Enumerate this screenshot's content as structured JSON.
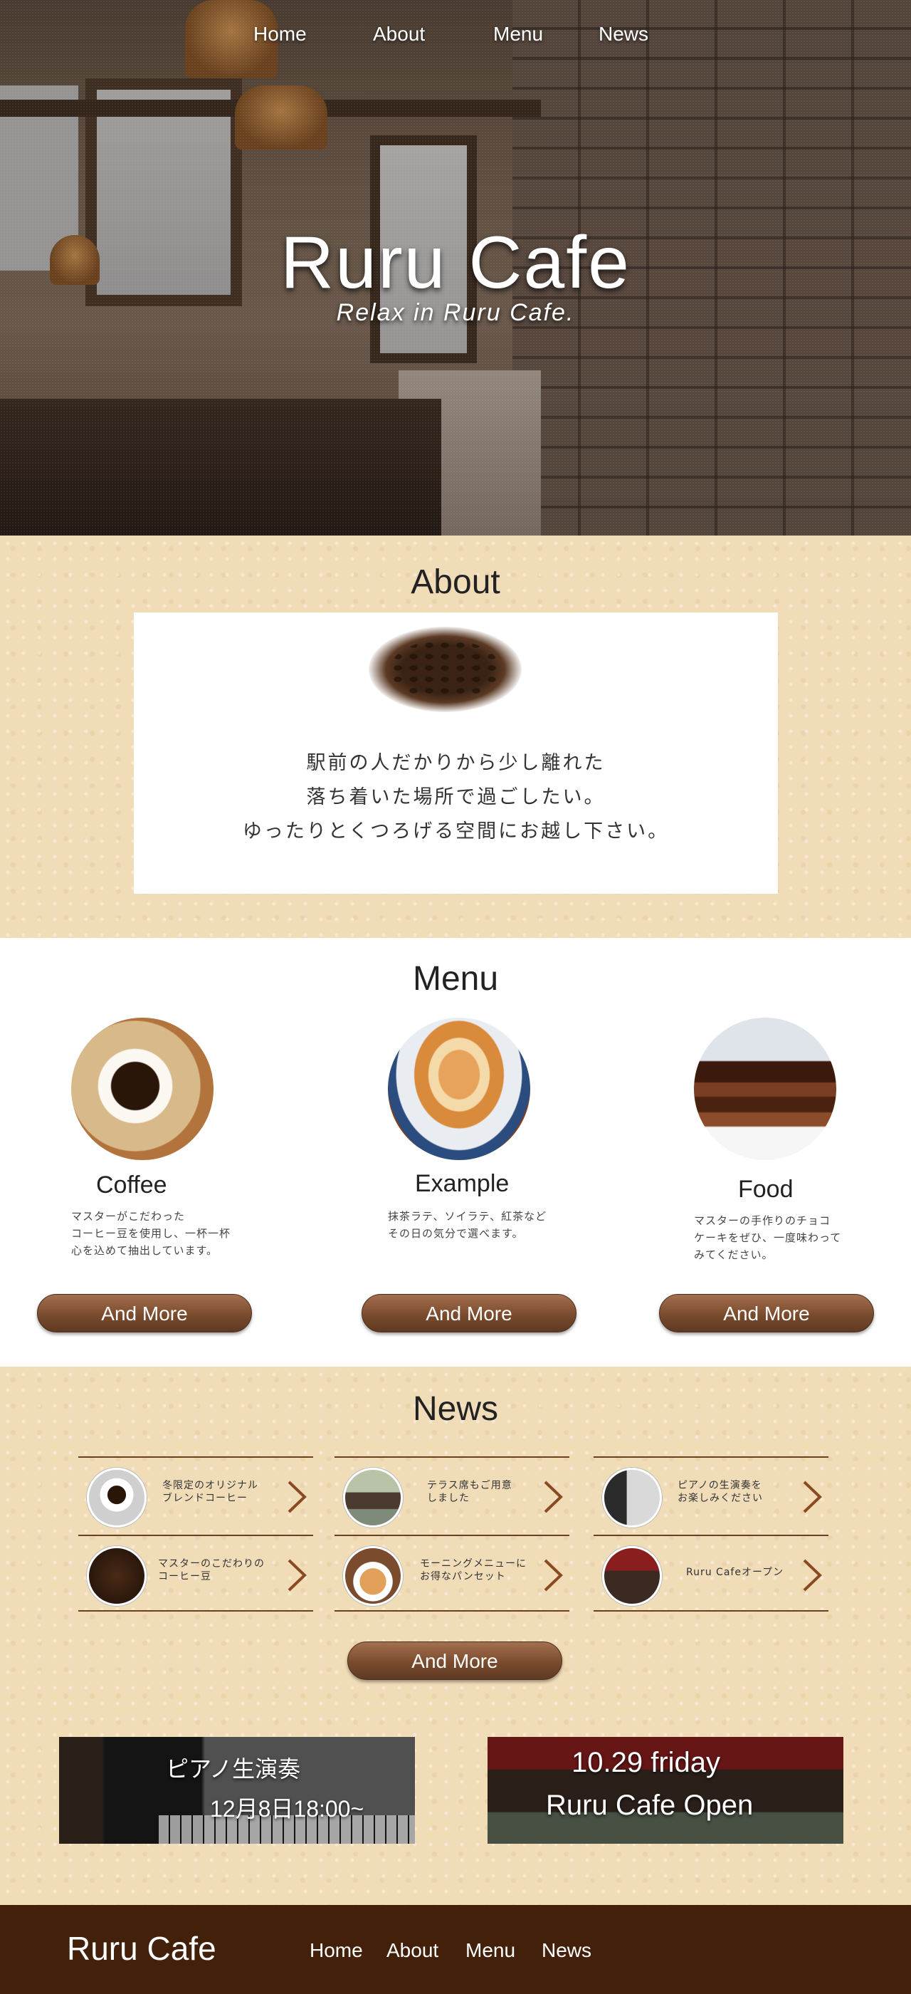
{
  "nav": {
    "home": "Home",
    "about": "About",
    "menu": "Menu",
    "news": "News"
  },
  "hero": {
    "title": "Ruru Cafe",
    "subtitle": "Relax in Ruru Cafe."
  },
  "about": {
    "title": "About",
    "lines": [
      "駅前の人だかりから少し離れた",
      "落ち着いた場所で過ごしたい。",
      "ゆったりとくつろげる空間にお越し下さい。"
    ]
  },
  "menu": {
    "title": "Menu",
    "items": [
      {
        "name": "Coffee",
        "desc": [
          "マスターがこだわった",
          "コーヒー豆を使用し、一杯一杯",
          "心を込めて抽出しています。"
        ],
        "button": "And More",
        "icon": "coffee-cup-image"
      },
      {
        "name": "Example",
        "desc": [
          "抹茶ラテ、ソイラテ、紅茶など",
          "その日の気分で選べます。"
        ],
        "button": "And More",
        "icon": "latte-art-image"
      },
      {
        "name": "Food",
        "desc": [
          "マスターの手作りのチョコ",
          "ケーキをぜひ、一度味わって",
          "みてください。"
        ],
        "button": "And More",
        "icon": "chocolate-cake-image"
      }
    ]
  },
  "news": {
    "title": "News",
    "items": [
      {
        "text": [
          "冬限定のオリジナル",
          "ブレンドコーヒー"
        ],
        "icon": "coffee-cup-thumb"
      },
      {
        "text": [
          "テラス席もご用意",
          "しました"
        ],
        "icon": "terrace-thumb"
      },
      {
        "text": [
          "ピアノの生演奏を",
          "お楽しみください"
        ],
        "icon": "piano-thumb"
      },
      {
        "text": [
          "マスターのこだわりの",
          "コーヒー豆"
        ],
        "icon": "coffee-beans-thumb"
      },
      {
        "text": [
          "モーニングメニューに",
          "お得なパンセット"
        ],
        "icon": "bread-thumb"
      },
      {
        "text": [
          "Ruru Cafeオープン"
        ],
        "icon": "cafe-front-thumb"
      }
    ],
    "button": "And More",
    "banners": [
      {
        "line1": "ピアノ生演奏",
        "line2": "12月8日18:00~",
        "icon": "piano-photo"
      },
      {
        "line1": "10.29  friday",
        "line2": "Ruru Cafe Open",
        "icon": "cafe-storefront-photo"
      }
    ]
  },
  "footer": {
    "brand": "Ruru Cafe",
    "home": "Home",
    "about": "About",
    "menu": "Menu",
    "news": "News"
  },
  "colors": {
    "brown": "#7a4b2d",
    "footer": "#43200a",
    "beige": "#f1dcb8"
  }
}
